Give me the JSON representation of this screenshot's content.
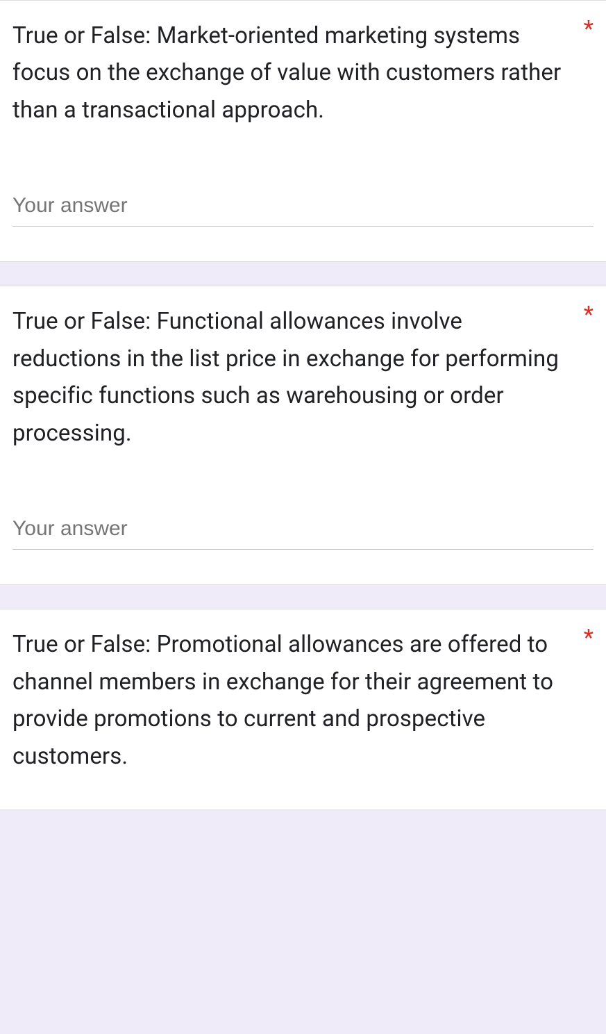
{
  "questions": [
    {
      "text": "True or False: Market-oriented marketing systems focus on the exchange of value with customers rather than a transactional approach.",
      "required": "*",
      "placeholder": "Your answer"
    },
    {
      "text": "True or False: Functional allowances involve reductions in the list price in exchange for performing specific functions such as warehousing or order processing.",
      "required": "*",
      "placeholder": "Your answer"
    },
    {
      "text": "True or False: Promotional allowances are offered to channel members in exchange for their agreement to provide promotions to current and prospective customers.",
      "required": "*",
      "placeholder": ""
    }
  ]
}
